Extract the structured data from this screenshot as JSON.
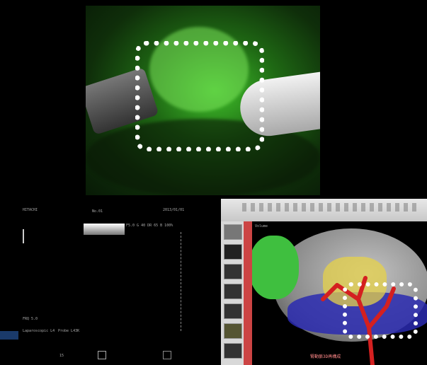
{
  "endoscope": {
    "highlight": "roi"
  },
  "ultrasound": {
    "header_left": "HITACHI",
    "header_mid": "No.01",
    "header_right": "2013/01/01",
    "row_values": "F5.0  G 40  DR 65  B 100%",
    "footer_left_a": "FRQ 5.0",
    "footer_left_b": "Laparoscopic L4",
    "footer_mid": "Probe L43K",
    "bottom_num": "15",
    "colors": {
      "bar": "#1a3a6a"
    }
  },
  "workstation": {
    "title_label": "Volume",
    "bottom_label": "腎動脈3D再構成",
    "colors": {
      "kidney": "#cfcfcf",
      "tumor": "#3fbf3f",
      "artery": "#d42020",
      "vein": "#2a2ab0",
      "ureter": "#e6d24a"
    }
  }
}
